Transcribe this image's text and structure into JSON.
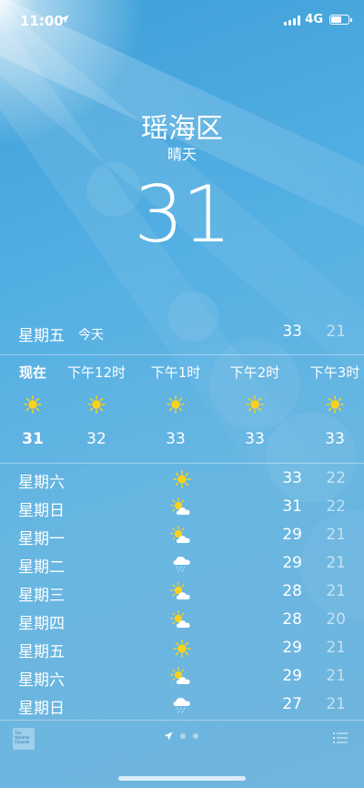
{
  "status": {
    "time": "11:00",
    "network": "4G"
  },
  "header": {
    "city": "瑶海区",
    "condition": "晴天",
    "temperature": "31"
  },
  "today": {
    "day": "星期五",
    "label": "今天",
    "high": "33",
    "low": "21"
  },
  "hourly": [
    {
      "time": "现在",
      "icon": "sun-icon",
      "temp": "31"
    },
    {
      "time": "下午12时",
      "icon": "sun-icon",
      "temp": "32"
    },
    {
      "time": "下午1时",
      "icon": "sun-icon",
      "temp": "33"
    },
    {
      "time": "下午2时",
      "icon": "sun-icon",
      "temp": "33"
    },
    {
      "time": "下午3时",
      "icon": "sun-icon",
      "temp": "33"
    }
  ],
  "daily": [
    {
      "day": "星期六",
      "icon": "sun-icon",
      "high": "33",
      "low": "22"
    },
    {
      "day": "星期日",
      "icon": "partly-cloudy-icon",
      "high": "31",
      "low": "22"
    },
    {
      "day": "星期一",
      "icon": "partly-cloudy-icon",
      "high": "29",
      "low": "21"
    },
    {
      "day": "星期二",
      "icon": "rain-cloud-icon",
      "high": "29",
      "low": "21"
    },
    {
      "day": "星期三",
      "icon": "partly-cloudy-icon",
      "high": "28",
      "low": "21"
    },
    {
      "day": "星期四",
      "icon": "partly-cloudy-icon",
      "high": "28",
      "low": "20"
    },
    {
      "day": "星期五",
      "icon": "sun-icon",
      "high": "29",
      "low": "21"
    },
    {
      "day": "星期六",
      "icon": "partly-cloudy-icon",
      "high": "29",
      "low": "21"
    },
    {
      "day": "星期日",
      "icon": "rain-cloud-icon",
      "high": "27",
      "low": "21"
    }
  ],
  "footer": {
    "logo_text": "The Weather Channel"
  }
}
